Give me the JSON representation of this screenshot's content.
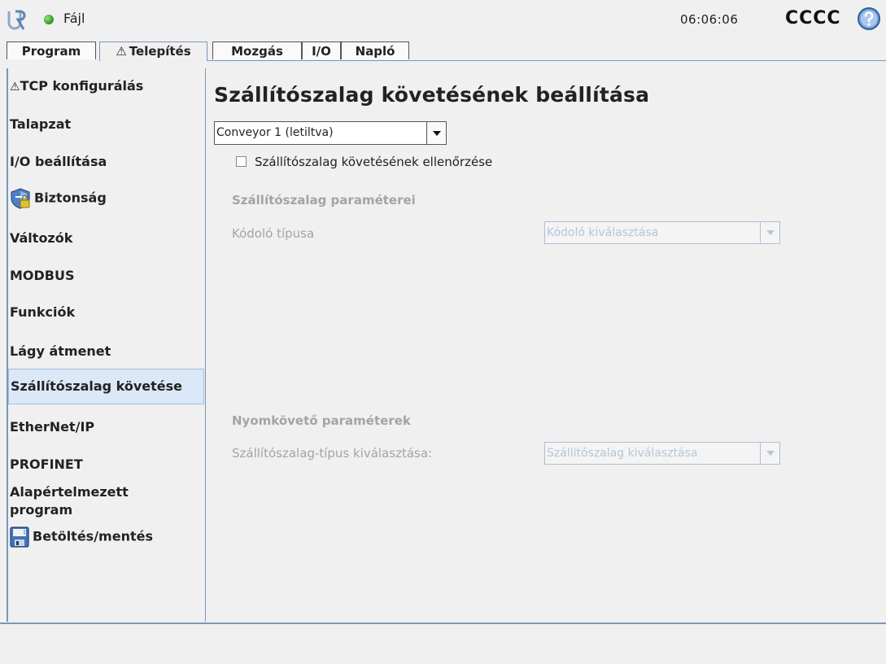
{
  "header": {
    "file_menu": "Fájl",
    "clock": "06:06:06",
    "robot_name": "CCCC",
    "status_color": "#3aa832",
    "accent_color": "#3d7cc9"
  },
  "tabs": [
    {
      "label": "Program",
      "active": false
    },
    {
      "label": "Telepítés",
      "active": true,
      "warning": "⚠"
    },
    {
      "label": "Mozgás",
      "active": false
    },
    {
      "label": "I/O",
      "active": false
    },
    {
      "label": "Napló",
      "active": false
    }
  ],
  "sidebar": {
    "items": [
      {
        "label": "TCP konfigurálás",
        "icon": "warning-icon",
        "warning": "⚠"
      },
      {
        "label": "Talapzat"
      },
      {
        "label": "I/O beállítása"
      },
      {
        "label": "Biztonság",
        "icon": "shield-icon"
      },
      {
        "label": "Változók"
      },
      {
        "label": "MODBUS"
      },
      {
        "label": "Funkciók"
      },
      {
        "label": "Lágy átmenet"
      },
      {
        "label": "Szállítószalag követése",
        "selected": true
      },
      {
        "label": "EtherNet/IP"
      },
      {
        "label": "PROFINET"
      },
      {
        "label": "Alapértelmezett program"
      },
      {
        "label": "Betöltés/mentés",
        "icon": "save-icon"
      }
    ]
  },
  "main": {
    "title": "Szállítószalag követésének beállítása",
    "conveyor_select": {
      "value": "Conveyor 1 (letiltva)"
    },
    "checkbox_label": "Szállítószalag követésének ellenőrzése",
    "checkbox_checked": false,
    "conveyor_params": {
      "title": "Szállítószalag paraméterei",
      "encoder_label": "Kódoló típusa",
      "encoder_placeholder": "Kódoló kiválasztása"
    },
    "tracking_params": {
      "title": "Nyomkövető paraméterek",
      "type_label": "Szállítószalag-típus kiválasztása:",
      "type_placeholder": "Szállítószalag kiválasztása"
    }
  }
}
